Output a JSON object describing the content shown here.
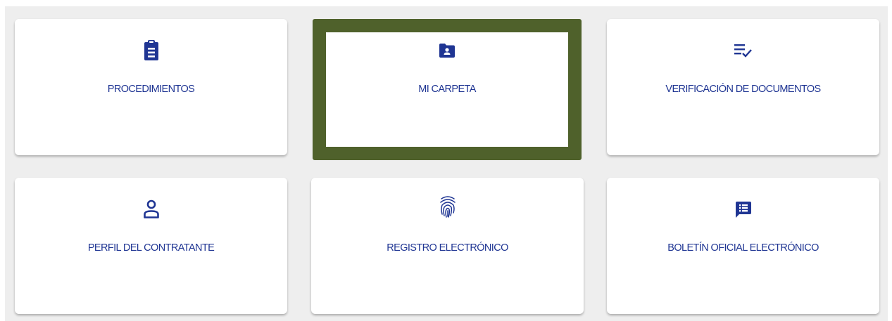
{
  "colors": {
    "icon": "#1f3593",
    "label": "#1f3593",
    "selected_border": "#4f612b",
    "background": "#eeeeee"
  },
  "cards": [
    {
      "label": "PROCEDIMIENTOS",
      "icon": "clipboard-list-icon",
      "selected": false
    },
    {
      "label": "MI CARPETA",
      "icon": "folder-user-icon",
      "selected": true
    },
    {
      "label": "VERIFICACIÓN DE DOCUMENTOS",
      "icon": "list-check-icon",
      "selected": false
    },
    {
      "label": "PERFIL DEL CONTRATANTE",
      "icon": "person-outline-icon",
      "selected": false
    },
    {
      "label": "REGISTRO ELECTRÓNICO",
      "icon": "fingerprint-icon",
      "selected": false
    },
    {
      "label": "BOLETÍN OFICIAL ELECTRÓNICO",
      "icon": "chat-list-icon",
      "selected": false
    }
  ]
}
